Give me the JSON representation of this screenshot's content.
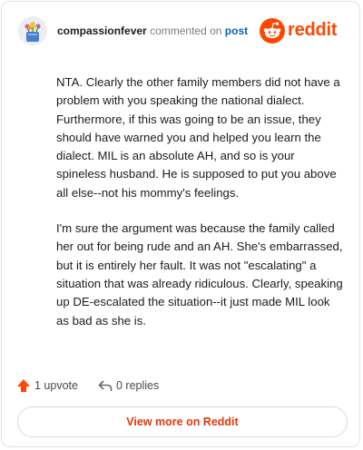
{
  "header": {
    "username": "compassionfever",
    "verb": "commented on",
    "post_link": "post",
    "brand_name": "reddit",
    "brand_color": "#ff4500",
    "avatar_icon": "avatar-flower-icon",
    "brand_icon": "reddit-snoo-icon"
  },
  "comment": {
    "paragraphs": [
      "NTA. Clearly the other family members did not have a problem with you speaking the national dialect. Furthermore, if this was going to be an issue, they should have warned you and helped you learn the dialect. MIL is an absolute AH, and so is your spineless husband. He is supposed to put you above all else--not his mommy's feelings.",
      "I'm sure the argument was because the family called her out for being rude and an AH. She's embarrassed, but it is entirely her fault. It was not \"escalating\" a situation that was already ridiculous. Clearly, speaking up DE-escalated the situation--it just made MIL look as bad as she is."
    ]
  },
  "actions": {
    "upvote_label": "1 upvote",
    "reply_label": "0 replies",
    "upvote_icon": "upvote-arrow-icon",
    "reply_icon": "reply-arrow-icon",
    "upvote_color": "#ff4500"
  },
  "footer": {
    "view_more_label": "View more on Reddit"
  }
}
